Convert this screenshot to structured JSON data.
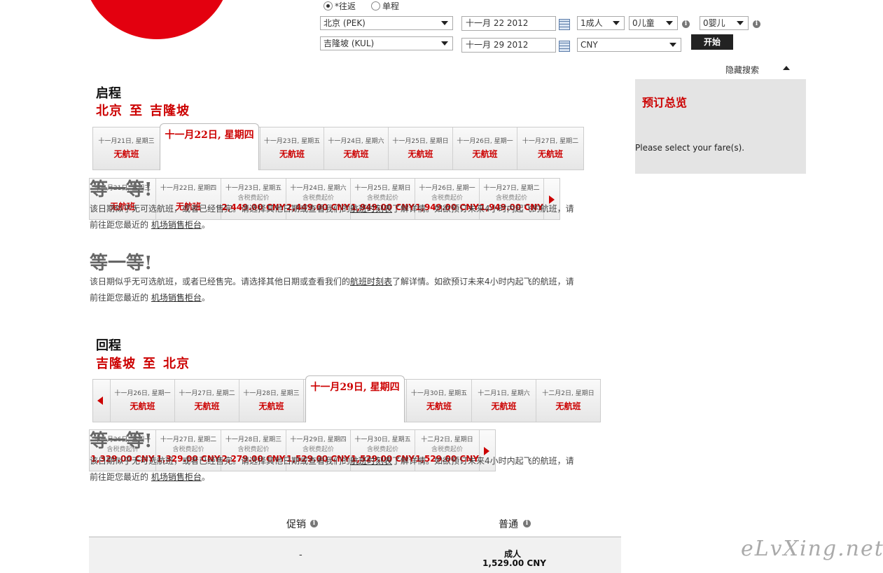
{
  "search": {
    "trip_roundtrip": "*往返",
    "trip_oneway": "单程",
    "origin": "北京 (PEK)",
    "destination": "吉隆坡 (KUL)",
    "depart_date": "十一月 22 2012",
    "return_date": "十一月 29 2012",
    "adults": "1成人",
    "children": "0儿童",
    "infants": "0婴儿",
    "currency": "CNY",
    "start_label": "开始",
    "hide_search": "隐藏搜索"
  },
  "summary": {
    "title": "预订总览",
    "text": "Please select your fare(s)."
  },
  "outbound": {
    "title": "启程",
    "from": "北京",
    "to_word": "至",
    "to": "吉隆坡",
    "selected": "十一月22日, 星期四",
    "days": [
      {
        "date": "十一月21日, 星期三",
        "status": "无航班"
      },
      {
        "date": "十一月23日, 星期五",
        "status": "无航班"
      },
      {
        "date": "十一月24日, 星期六",
        "status": "无航班"
      },
      {
        "date": "十一月25日, 星期日",
        "status": "无航班"
      },
      {
        "date": "十一月26日, 星期一",
        "status": "无航班"
      },
      {
        "date": "十一月27日, 星期二",
        "status": "无航班"
      }
    ],
    "ghost_days": [
      {
        "date": "十一月21日, 星期三",
        "sub": "",
        "price": "无航班"
      },
      {
        "date": "十一月22日, 星期四",
        "sub": "",
        "price": "无航班"
      },
      {
        "date": "十一月23日, 星期五",
        "sub": "含税费起价",
        "price": "2,449.00 CNY"
      },
      {
        "date": "十一月24日, 星期六",
        "sub": "含税费起价",
        "price": "2,449.00 CNY"
      },
      {
        "date": "十一月25日, 星期日",
        "sub": "含税费起价",
        "price": "1,949.00 CNY"
      },
      {
        "date": "十一月26日, 星期一",
        "sub": "含税费起价",
        "price": "1,949.00 CNY"
      },
      {
        "date": "十一月27日, 星期二",
        "sub": "含税费起价",
        "price": "1,949.00 CNY"
      }
    ]
  },
  "inbound": {
    "title": "回程",
    "from": "吉隆坡",
    "to_word": "至",
    "to": "北京",
    "selected": "十一月29日, 星期四",
    "days_before": [
      {
        "date": "十一月26日, 星期一",
        "status": "无航班"
      },
      {
        "date": "十一月27日, 星期二",
        "status": "无航班"
      },
      {
        "date": "十一月28日, 星期三",
        "status": "无航班"
      }
    ],
    "days_after": [
      {
        "date": "十一月30日, 星期五",
        "status": "无航班"
      },
      {
        "date": "十二月1日, 星期六",
        "status": "无航班"
      },
      {
        "date": "十二月2日, 星期日",
        "status": "无航班"
      }
    ],
    "ghost_days": [
      {
        "date": "十一月26日, 星期一",
        "sub": "含税费起价",
        "price": "1,329.00 CNY"
      },
      {
        "date": "十一月27日, 星期二",
        "sub": "含税费起价",
        "price": "1,329.00 CNY"
      },
      {
        "date": "十一月28日, 星期三",
        "sub": "含税费起价",
        "price": "2,279.00 CNY"
      },
      {
        "date": "十一月29日, 星期四",
        "sub": "含税费起价",
        "price": "1,529.00 CNY"
      },
      {
        "date": "十一月30日, 星期五",
        "sub": "含税费起价",
        "price": "1,529.00 CNY"
      },
      {
        "date": "十二月2日, 星期日",
        "sub": "含税费起价",
        "price": "1,529.00 CNY"
      }
    ]
  },
  "notice": {
    "heading": "等一等!",
    "line1_a": "该日期似乎无可选航班，或者已经售完。请选择其他日期或查看我们的",
    "timetable_link": "航班时刻表",
    "line1_b": "了解详情。如欲预订未来4小时内起飞的航班，请",
    "line2_a": "前往距您最近的",
    "counter_link": "机场销售柜台",
    "line2_b": "。"
  },
  "fares": {
    "promo_header": "促销",
    "regular_header": "普通",
    "promo_value": "-",
    "regular_label": "成人",
    "regular_price": "1,529.00 CNY"
  },
  "watermark": "eLvXing.net"
}
